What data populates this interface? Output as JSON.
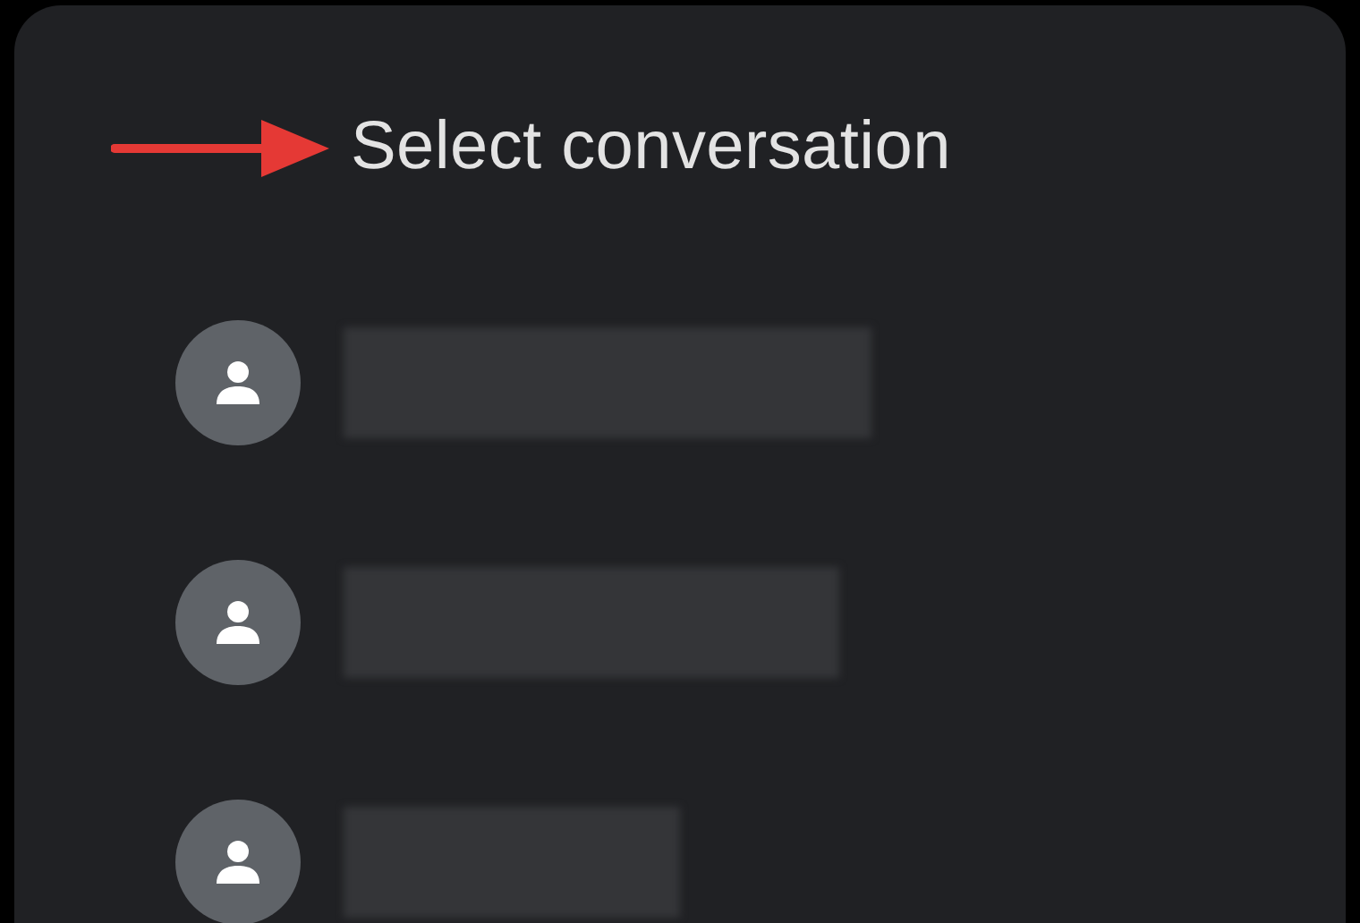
{
  "title": "Select conversation",
  "annotation": {
    "kind": "arrow"
  },
  "contacts": [
    {
      "kind": "redacted"
    },
    {
      "kind": "redacted"
    },
    {
      "kind": "redacted"
    }
  ]
}
